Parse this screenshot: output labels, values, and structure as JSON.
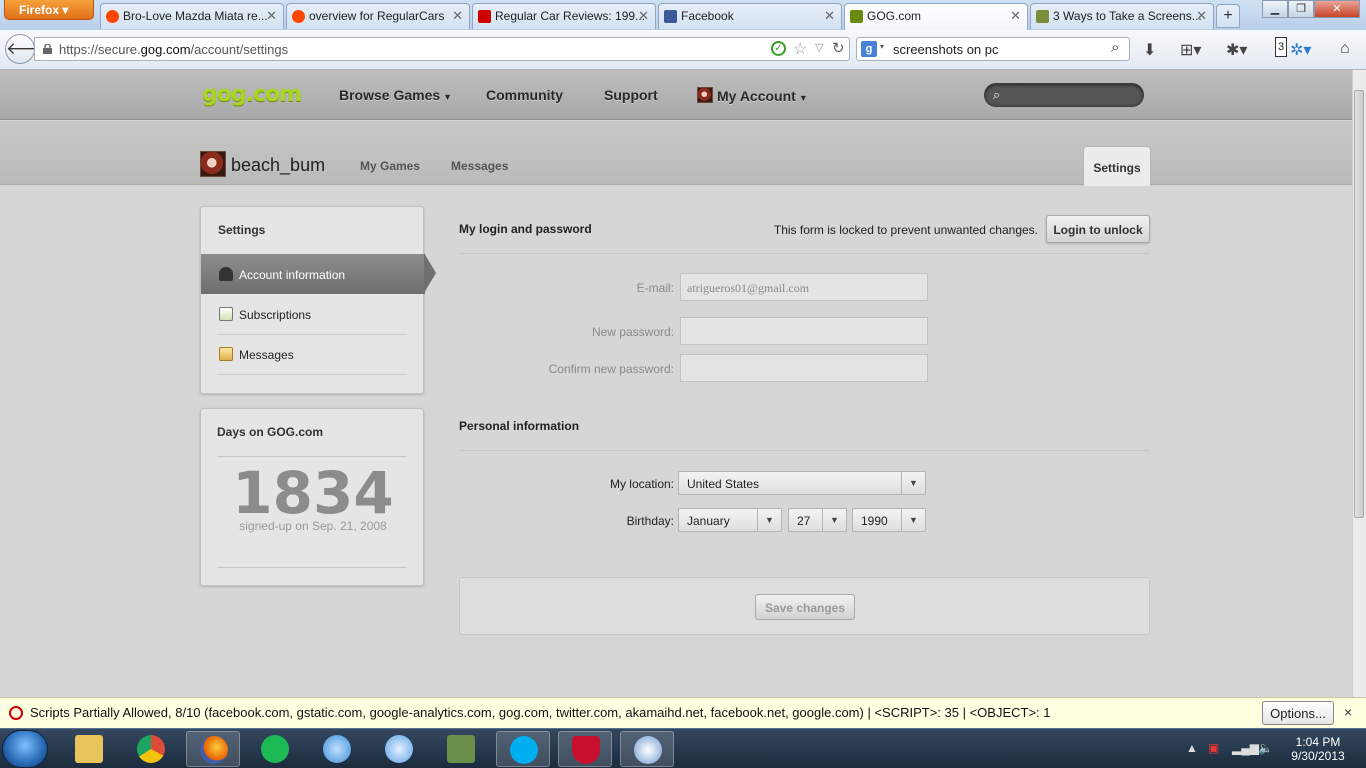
{
  "browser": {
    "menu_button": "Firefox",
    "tabs": [
      {
        "label": "Bro-Love Mazda Miata re...",
        "favicon_color": "#ff4500"
      },
      {
        "label": "overview for RegularCars",
        "favicon_color": "#ff4500"
      },
      {
        "label": "Regular Car Reviews: 199...",
        "favicon_color": "#cc0000"
      },
      {
        "label": "Facebook",
        "favicon_color": "#3b5998"
      },
      {
        "label": "GOG.com",
        "favicon_color": "#6a8a12"
      },
      {
        "label": "3 Ways to Take a Screens...",
        "favicon_color": "#7b8f3a"
      }
    ],
    "new_tab": "+",
    "url_prefix": "https://secure.",
    "url_domain": "gog.com",
    "url_path": "/account/settings",
    "search_value": "screenshots on pc",
    "search_engine_badge": "g",
    "counter_badge": "3"
  },
  "site": {
    "logo": "gog.com",
    "nav": {
      "browse": "Browse Games",
      "community": "Community",
      "support": "Support",
      "account": "My Account"
    },
    "user": {
      "name": "beach_bum",
      "my_games": "My Games",
      "messages": "Messages",
      "settings_tab": "Settings"
    },
    "sidebar": {
      "title": "Settings",
      "items": [
        {
          "label": "Account information",
          "active": true
        },
        {
          "label": "Subscriptions",
          "active": false
        },
        {
          "label": "Messages",
          "active": false
        }
      ]
    },
    "days": {
      "title": "Days on GOG.com",
      "count": "1834",
      "since": "signed-up on Sep. 21, 2008"
    },
    "login": {
      "title": "My login and password",
      "lock_notice": "This form is locked to prevent unwanted changes.",
      "unlock_button": "Login to unlock",
      "email_label": "E-mail:",
      "email_value": "atrigueros01@gmail.com",
      "new_password_label": "New password:",
      "confirm_password_label": "Confirm new password:"
    },
    "personal": {
      "title": "Personal information",
      "location_label": "My location:",
      "location_value": "United States",
      "birthday_label": "Birthday:",
      "birth_month": "January",
      "birth_day": "27",
      "birth_year": "1990"
    },
    "save_button": "Save changes"
  },
  "noscript": {
    "message": "Scripts Partially Allowed, 8/10 (facebook.com, gstatic.com, google-analytics.com, gog.com, twitter.com, akamaihd.net, facebook.net, google.com) | <SCRIPT>: 35 | <OBJECT>: 1",
    "options_button": "Options...",
    "close": "×"
  },
  "taskbar": {
    "apps": [
      {
        "name": "explorer",
        "color": "#e8c45a"
      },
      {
        "name": "chrome",
        "color": "#dd4b39"
      },
      {
        "name": "firefox",
        "color": "#e66000"
      },
      {
        "name": "spotify",
        "color": "#1db954"
      },
      {
        "name": "thunderbird",
        "color": "#3d8fd8"
      },
      {
        "name": "itunes",
        "color": "#5aa0e8"
      },
      {
        "name": "steam-like",
        "color": "#6a8f4a"
      },
      {
        "name": "skype",
        "color": "#00aff0"
      },
      {
        "name": "mcafee",
        "color": "#c8102e"
      },
      {
        "name": "updater",
        "color": "#6f9bd2"
      }
    ],
    "time": "1:04 PM",
    "date": "9/30/2013"
  }
}
